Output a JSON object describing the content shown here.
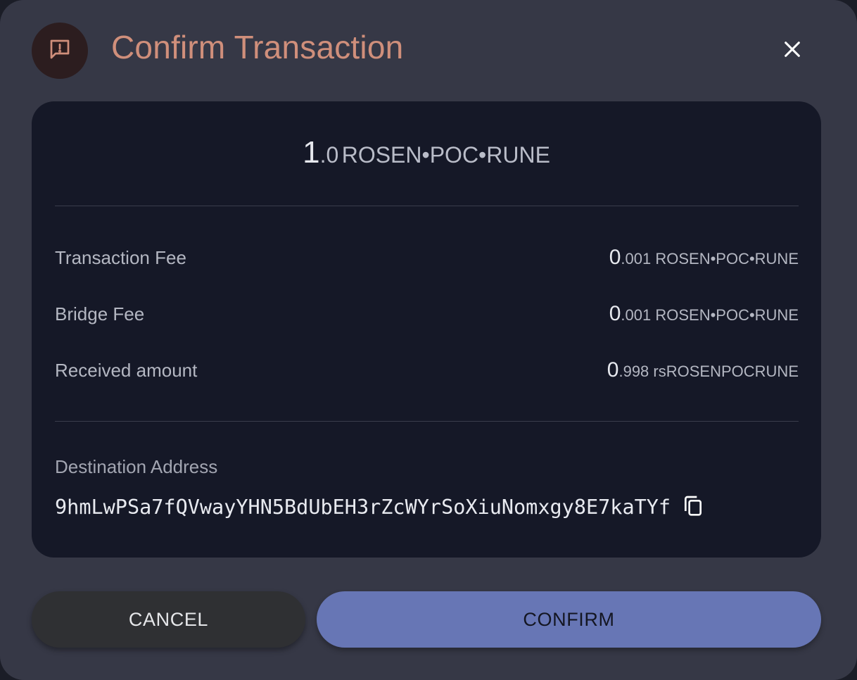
{
  "dialog": {
    "title": "Confirm Transaction",
    "header_icon": "feedback-alert-icon",
    "close_icon": "close-icon"
  },
  "summary": {
    "amount_int": "1",
    "amount_frac": ".0",
    "amount_unit": "ROSEN•POC•RUNE"
  },
  "fees": [
    {
      "label": "Transaction Fee",
      "value_int": "0",
      "value_frac": ".001",
      "unit": "ROSEN•POC•RUNE"
    },
    {
      "label": "Bridge Fee",
      "value_int": "0",
      "value_frac": ".001",
      "unit": "ROSEN•POC•RUNE"
    },
    {
      "label": "Received amount",
      "value_int": "0",
      "value_frac": ".998",
      "unit": "rsROSENPOCRUNE"
    }
  ],
  "destination": {
    "label": "Destination Address",
    "address": "9hmLwPSa7fQVwayYHN5BdUbEH3rZcWYrSoXiuNomxgy8E7kaTYf",
    "copy_icon": "copy-icon"
  },
  "actions": {
    "cancel_label": "CANCEL",
    "confirm_label": "CONFIRM"
  },
  "colors": {
    "title": "#d08f7b",
    "confirm_button": "#6776b5",
    "cancel_button": "#2f3033",
    "card_background": "#151827",
    "dialog_background": "#363846"
  }
}
